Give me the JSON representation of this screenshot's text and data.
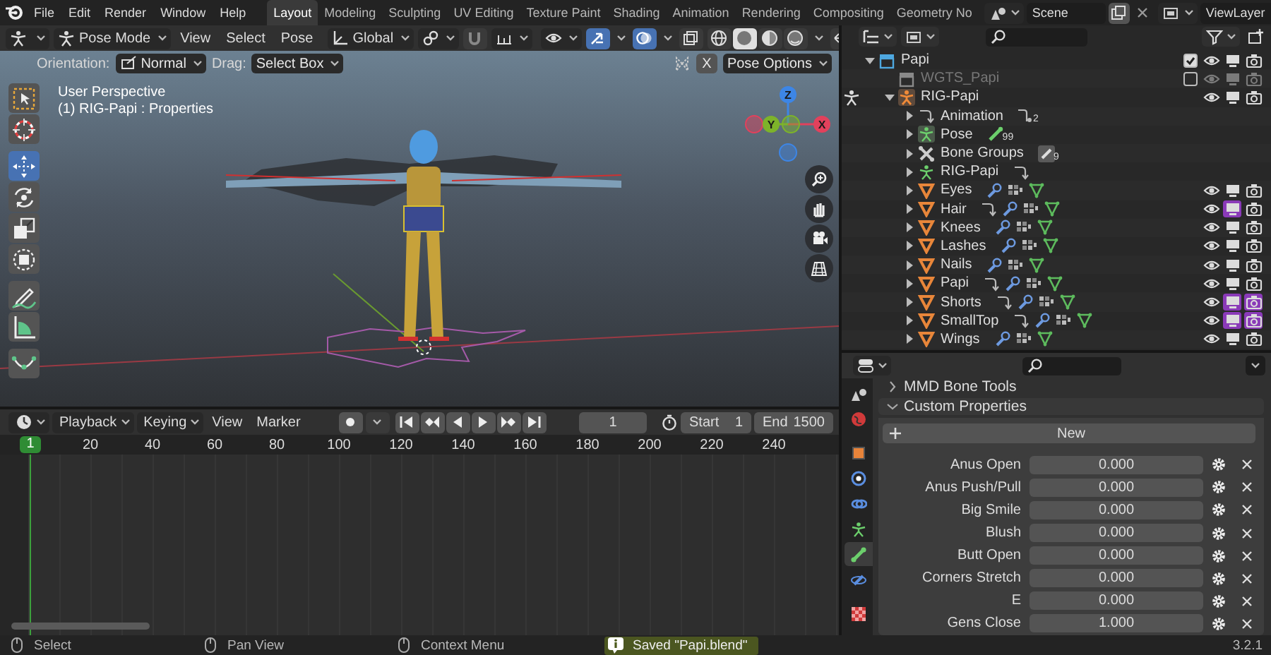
{
  "top_bar": {
    "menus": [
      "File",
      "Edit",
      "Render",
      "Window",
      "Help"
    ],
    "workspaces": [
      {
        "label": "Layout",
        "selected": true
      },
      {
        "label": "Modeling",
        "selected": false
      },
      {
        "label": "Sculpting",
        "selected": false
      },
      {
        "label": "UV Editing",
        "selected": false
      },
      {
        "label": "Texture Paint",
        "selected": false
      },
      {
        "label": "Shading",
        "selected": false
      },
      {
        "label": "Animation",
        "selected": false
      },
      {
        "label": "Rendering",
        "selected": false
      },
      {
        "label": "Compositing",
        "selected": false
      },
      {
        "label": "Geometry No",
        "selected": false
      }
    ],
    "scene": "Scene",
    "view_layer": "ViewLayer"
  },
  "viewport_header": {
    "mode": "Pose Mode",
    "menus": [
      "View",
      "Select",
      "Pose"
    ],
    "orientation": "Global",
    "toggles": [
      {
        "kind": "gizmo",
        "on": true
      },
      {
        "kind": "overlay",
        "on": true
      },
      {
        "kind": "xray",
        "on": false
      }
    ],
    "shading": [
      {
        "kind": "wireframe",
        "selected": false
      },
      {
        "kind": "solid",
        "selected": true
      },
      {
        "kind": "material",
        "selected": false
      },
      {
        "kind": "rendered",
        "selected": false
      }
    ]
  },
  "tool_settings": {
    "orientation_label": "Orientation:",
    "orientation": "Normal",
    "drag_label": "Drag:",
    "drag": "Select Box",
    "x_mirror": "X",
    "x_mirror_on": false,
    "pose_options": "Pose Options"
  },
  "viewport": {
    "overlay_text": [
      "User Perspective",
      "(1) RIG-Papi : Properties"
    ],
    "tool_groups": [
      [
        {
          "kind": "select_box",
          "selected": false
        },
        {
          "kind": "cursor",
          "selected": false
        }
      ],
      [
        {
          "kind": "move",
          "selected": true
        },
        {
          "kind": "rotate",
          "selected": false
        },
        {
          "kind": "scale",
          "selected": false
        },
        {
          "kind": "transform",
          "selected": false
        }
      ],
      [
        {
          "kind": "annotate",
          "selected": false
        },
        {
          "kind": "measure",
          "selected": false
        }
      ],
      [
        {
          "kind": "roll",
          "selected": false
        }
      ]
    ],
    "axes": [
      {
        "label": "Z",
        "color": "#3d86e6"
      },
      {
        "label": "Y",
        "color": "#7db32a"
      },
      {
        "label": "X",
        "color": "#e2415c"
      }
    ]
  },
  "timeline": {
    "menus": [
      {
        "label": "Playback",
        "dropdown": true
      },
      {
        "label": "Keying",
        "dropdown": true
      },
      {
        "label": "View",
        "dropdown": false
      },
      {
        "label": "Marker",
        "dropdown": false
      }
    ],
    "current_frame": "1",
    "start_label": "Start",
    "start": "1",
    "end_label": "End",
    "end": "1500",
    "playhead_label": "1",
    "ruler": [
      "20",
      "40",
      "60",
      "80",
      "100",
      "120",
      "140",
      "160",
      "180",
      "200",
      "220",
      "240"
    ]
  },
  "outliner": {
    "items": [
      {
        "name": "Papi",
        "kind": "collection",
        "expanded": true,
        "checked": true,
        "disabled": false,
        "children": [
          {
            "name": "WGTS_Papi",
            "kind": "collection",
            "checked": false,
            "disabled": true
          },
          {
            "name": "RIG-Papi",
            "kind": "armature",
            "expanded": true,
            "in_pose_mode": true,
            "children": [
              {
                "name": "Animation",
                "kind": "animation",
                "expanded": false,
                "count": "2"
              },
              {
                "name": "Pose",
                "kind": "pose",
                "expanded": false,
                "count": "99"
              },
              {
                "name": "Bone Groups",
                "kind": "bone_groups",
                "expanded": false,
                "count": "9"
              },
              {
                "name": "RIG-Papi",
                "kind": "armature_data",
                "expanded": false,
                "has_animation": true
              },
              {
                "name": "Eyes",
                "kind": "mesh",
                "expanded": false,
                "has_animation": false,
                "display_highlighted": false,
                "render_highlighted": false
              },
              {
                "name": "Hair",
                "kind": "mesh",
                "expanded": false,
                "has_animation": true,
                "display_highlighted": true,
                "render_highlighted": false
              },
              {
                "name": "Knees",
                "kind": "mesh",
                "expanded": false,
                "has_animation": false,
                "display_highlighted": false,
                "render_highlighted": false
              },
              {
                "name": "Lashes",
                "kind": "mesh",
                "expanded": false,
                "has_animation": false,
                "display_highlighted": false,
                "render_highlighted": false
              },
              {
                "name": "Nails",
                "kind": "mesh",
                "expanded": false,
                "has_animation": false,
                "display_highlighted": false,
                "render_highlighted": false
              },
              {
                "name": "Papi",
                "kind": "mesh",
                "expanded": false,
                "has_animation": true,
                "display_highlighted": false,
                "render_highlighted": false
              },
              {
                "name": "Shorts",
                "kind": "mesh",
                "expanded": false,
                "has_animation": true,
                "display_highlighted": true,
                "render_highlighted": true
              },
              {
                "name": "SmallTop",
                "kind": "mesh",
                "expanded": false,
                "has_animation": true,
                "display_highlighted": true,
                "render_highlighted": true
              },
              {
                "name": "Wings",
                "kind": "mesh",
                "expanded": false,
                "has_animation": false,
                "display_highlighted": false,
                "render_highlighted": false
              }
            ]
          }
        ]
      }
    ]
  },
  "properties": {
    "tabs": [
      {
        "kind": "scene",
        "selected": false
      },
      {
        "kind": "world",
        "selected": false
      },
      {
        "kind": "object",
        "selected": false
      },
      {
        "kind": "physics",
        "selected": false
      },
      {
        "kind": "constraints",
        "selected": false
      },
      {
        "kind": "armature",
        "selected": false
      },
      {
        "kind": "bone",
        "selected": true
      },
      {
        "kind": "bone_constraints",
        "selected": false
      },
      {
        "kind": "texture",
        "selected": false
      }
    ],
    "panels": [
      {
        "title": "MMD Bone Tools",
        "expanded": false
      },
      {
        "title": "Custom Properties",
        "expanded": true
      }
    ],
    "new_button": "New",
    "custom_properties": [
      {
        "name": "Anus Open",
        "value": "0.000"
      },
      {
        "name": "Anus Push/Pull",
        "value": "0.000"
      },
      {
        "name": "Big Smile",
        "value": "0.000"
      },
      {
        "name": "Blush",
        "value": "0.000"
      },
      {
        "name": "Butt Open",
        "value": "0.000"
      },
      {
        "name": "Corners Stretch",
        "value": "0.000"
      },
      {
        "name": "E",
        "value": "0.000"
      },
      {
        "name": "Gens Close",
        "value": "1.000"
      }
    ]
  },
  "status_bar": {
    "hints": [
      "Select",
      "Pan View",
      "Context Menu"
    ],
    "message": "Saved \"Papi.blend\"",
    "version": "3.2.1"
  }
}
